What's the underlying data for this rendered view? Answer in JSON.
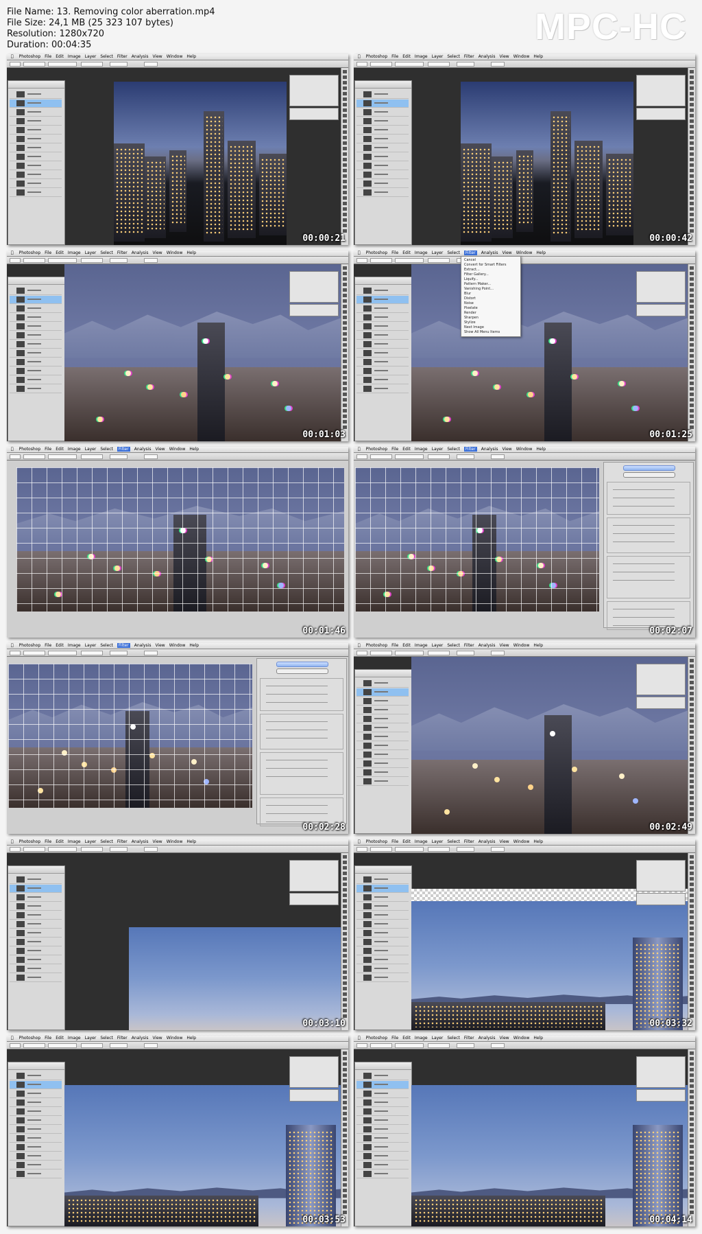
{
  "header": {
    "file_name": "File Name: 13. Removing color aberration.mp4",
    "file_size": "File Size: 24,1 MB (25 323 107 bytes)",
    "resolution": "Resolution: 1280x720",
    "duration": "Duration: 00:04:35",
    "logo": "MPC-HC"
  },
  "menu": [
    "Photoshop",
    "File",
    "Edit",
    "Image",
    "Layer",
    "Select",
    "Filter",
    "Analysis",
    "View",
    "Window",
    "Help"
  ],
  "filter_menu": [
    "Convert for Smart Filters",
    "Extract...",
    "Filter Gallery...",
    "Liquify...",
    "Pattern Maker...",
    "Vanishing Point...",
    "Blur",
    "Distort",
    "Noise",
    "Pixelate",
    "Render",
    "Sharpen",
    "Stylize",
    "Next Image",
    "Show All Menu Items"
  ],
  "filter_last": "Cancel",
  "thumbnails": [
    {
      "time": "00:00:21"
    },
    {
      "time": "00:00:42"
    },
    {
      "time": "00:01:03"
    },
    {
      "time": "00:01:25"
    },
    {
      "time": "00:01:46"
    },
    {
      "time": "00:02:07"
    },
    {
      "time": "00:02:28"
    },
    {
      "time": "00:02:49"
    },
    {
      "time": "00:03:10"
    },
    {
      "time": "00:03:32"
    },
    {
      "time": "00:03:53"
    },
    {
      "time": "00:04:14"
    }
  ],
  "colors": {
    "fringe": "#e042c9",
    "selection": "#8fc0f0",
    "menu_highlight": "#3a6fd8"
  }
}
